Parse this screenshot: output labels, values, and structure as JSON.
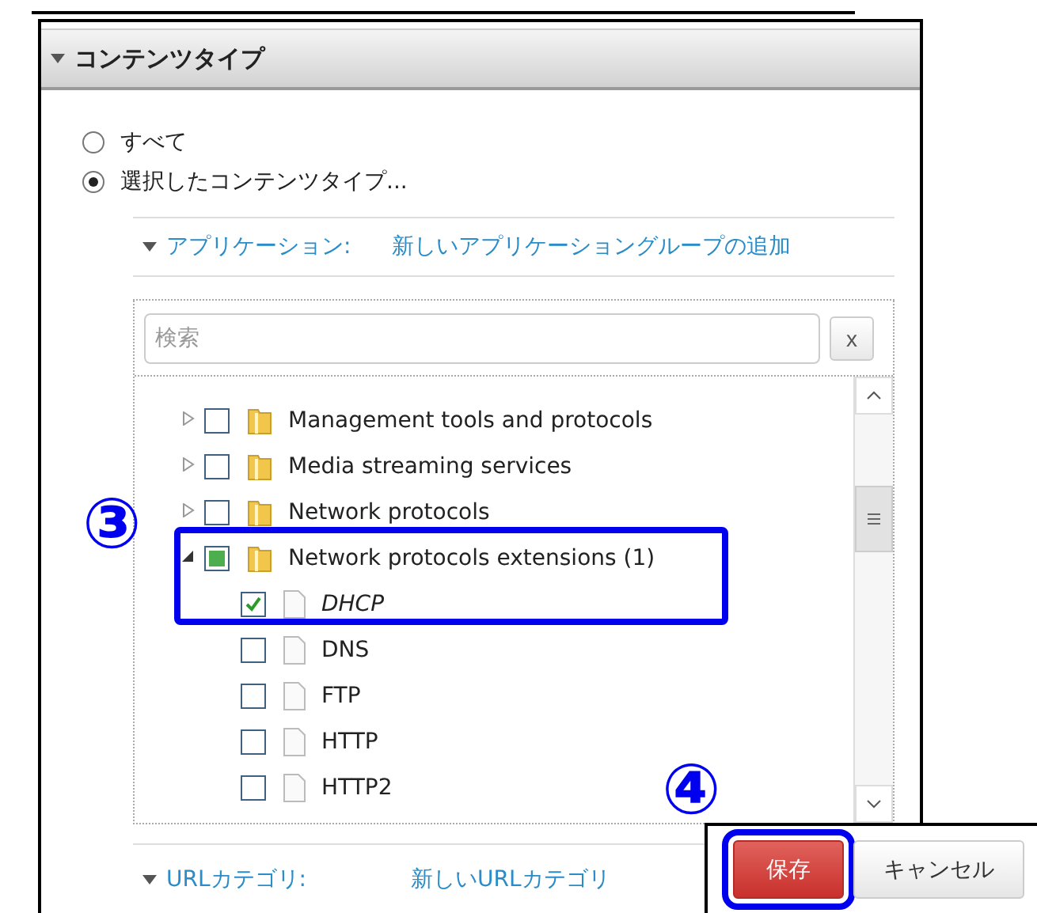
{
  "panel": {
    "title": "コンテンツタイプ",
    "expanded": true
  },
  "scope_options": [
    {
      "label": "すべて",
      "selected": false
    },
    {
      "label": "選択したコンテンツタイプ...",
      "selected": true
    }
  ],
  "applications": {
    "label": "アプリケーション:",
    "expanded": true,
    "add_link": "新しいアプリケーショングループの追加"
  },
  "search": {
    "placeholder": "検索",
    "clear": "x"
  },
  "tree": [
    {
      "kind": "folder",
      "label": "Management tools and protocols",
      "expanded": false,
      "checked": false,
      "partial": false
    },
    {
      "kind": "folder",
      "label": "Media streaming services",
      "expanded": false,
      "checked": false,
      "partial": false
    },
    {
      "kind": "folder",
      "label": "Network protocols",
      "expanded": false,
      "checked": false,
      "partial": false
    },
    {
      "kind": "folder",
      "label": "Network protocols extensions (1)",
      "expanded": true,
      "checked": false,
      "partial": true,
      "children": [
        {
          "kind": "file",
          "label": "DHCP",
          "checked": true
        },
        {
          "kind": "file",
          "label": "DNS",
          "checked": false
        },
        {
          "kind": "file",
          "label": "FTP",
          "checked": false
        },
        {
          "kind": "file",
          "label": "HTTP",
          "checked": false
        },
        {
          "kind": "file",
          "label": "HTTP2",
          "checked": false
        }
      ]
    }
  ],
  "url_categories": {
    "label": "URLカテゴリ:",
    "expanded": true,
    "add_link": "新しいURLカテゴリ"
  },
  "buttons": [
    {
      "label": "保存",
      "kind": "primary"
    },
    {
      "label": "キャンセル",
      "kind": "secondary"
    }
  ],
  "annotations": [
    {
      "label": "③"
    },
    {
      "label": "④"
    }
  ]
}
